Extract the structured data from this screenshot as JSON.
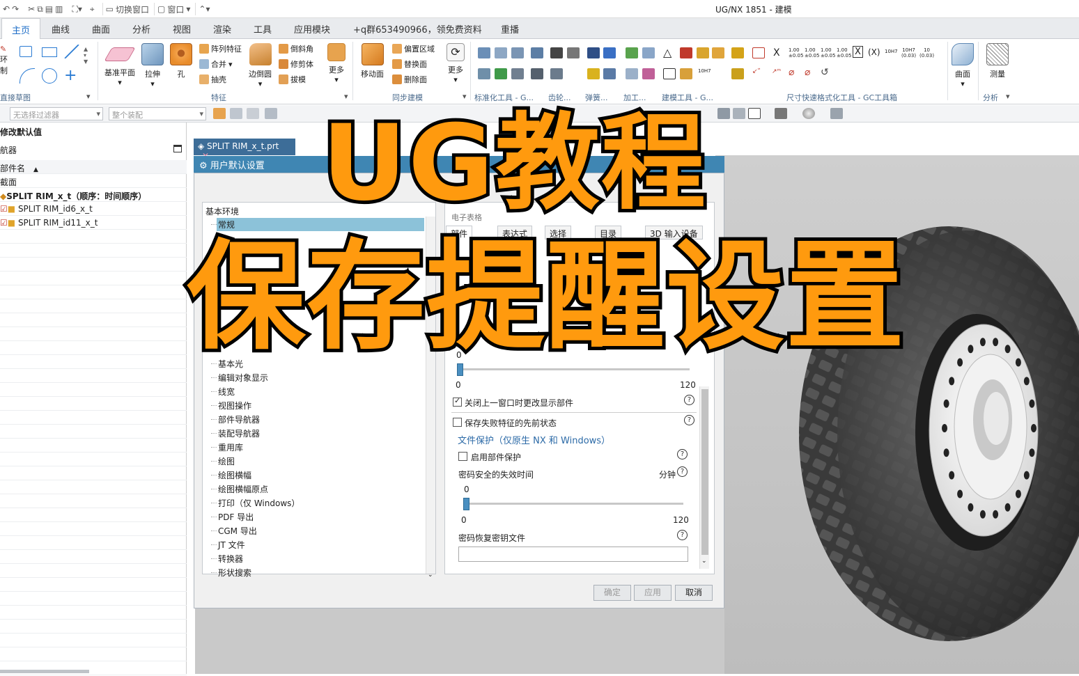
{
  "window": {
    "title": "UG/NX 1851 - 建模"
  },
  "quick_access": {
    "switch_window": "切换窗口",
    "window_menu": "窗口"
  },
  "menu_tabs": [
    "主页",
    "曲线",
    "曲面",
    "分析",
    "视图",
    "渲染",
    "工具",
    "应用模块",
    "+q群653490966，领免费资料",
    "重播"
  ],
  "ribbon": {
    "sketch_labels": [
      "环",
      "制"
    ],
    "sketch_group": "直接草图",
    "feature": {
      "big": [
        "基准平面",
        "拉伸",
        "孔"
      ],
      "small": [
        "阵列特征",
        "合并",
        "抽壳"
      ],
      "small2": [
        "边倒圆"
      ],
      "small3": [
        "倒斜角",
        "修剪体",
        "拔模"
      ],
      "more": "更多",
      "group": "特征"
    },
    "sync": {
      "big": [
        "移动面"
      ],
      "small": [
        "偏置区域",
        "替换面",
        "删除面"
      ],
      "more": "更多",
      "group": "同步建模"
    },
    "groups": [
      "标准化工具 - G...",
      "齿轮...",
      "弹簧...",
      "加工...",
      "建模工具 - G...",
      "尺寸快速格式化工具 - GC工具箱",
      "分析"
    ],
    "surface": "曲面",
    "measure": "测量",
    "dim_codes": [
      "X",
      "(X)",
      "10H7",
      "10H7",
      "10"
    ]
  },
  "filterbar": {
    "filter": "无选择过滤器",
    "assembly": "整个装配"
  },
  "navigator": {
    "title": "修改默认值",
    "header": "航器",
    "column": "部件名",
    "section": "截面",
    "root": "SPLIT RIM_x_t（顺序：时间顺序）",
    "children": [
      "SPLIT RIM_id6_x_t",
      "SPLIT RIM_id11_x_t"
    ]
  },
  "dialog": {
    "file_tab": "SPLIT RIM_x_t.prt",
    "title": "用户默认设置",
    "tree": {
      "root": "基本环境",
      "items": [
        "常规",
        "基本光",
        "编辑对象显示",
        "线宽",
        "视图操作",
        "部件导航器",
        "装配导航器",
        "重用库",
        "绘图",
        "绘图横幅",
        "绘图横幅原点",
        "打印（仅 Windows）",
        "PDF 导出",
        "CGM 导出",
        "JT 文件",
        "转换器",
        "形状搜索"
      ]
    },
    "tabs": [
      "部件",
      "表达式",
      "选择",
      "目录",
      "3D 输入设备"
    ],
    "partial_top": "电子表格",
    "slider1": {
      "min": "0",
      "max": "120",
      "top": "0",
      "value": 0
    },
    "close_window_label": "关闭上一窗口时更改显示部件",
    "save_failed_label": "保存失败特征的先前状态",
    "file_protect_title": "文件保护（仅原生 NX 和 Windows）",
    "enable_protect_label": "启用部件保护",
    "pwd_timeout_label": "密码安全的失效时间",
    "unit_minutes": "分钟",
    "slider2": {
      "value_label": "0",
      "min": "0",
      "max": "120",
      "value": 0
    },
    "recovery_key_label": "密码恢复密钥文件",
    "buttons": {
      "ok": "确定",
      "apply": "应用",
      "cancel": "取消"
    }
  },
  "overlay": {
    "line1": "UG教程",
    "line2": "保存提醒设置"
  },
  "colors": {
    "overlay_fill": "#ff9a0e",
    "dialog_header": "#3f86b3",
    "accent": "#1c6cc7"
  }
}
